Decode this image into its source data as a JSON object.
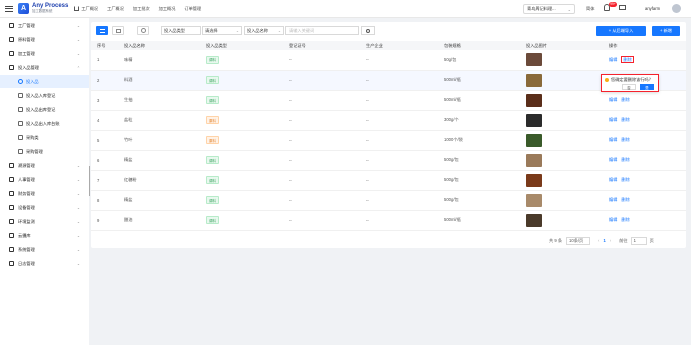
{
  "header": {
    "logo_mark": "A",
    "logo_name": "Any Process",
    "logo_sub": "加工数据系统",
    "nav": [
      "工厂概况",
      "工厂概况",
      "加工批次",
      "加工概况",
      "订单管理"
    ],
    "shop": "青岛周记料理...",
    "lang": "简体",
    "notify_count": "99+",
    "user": "anyfarm"
  },
  "sidebar": {
    "items": [
      {
        "label": "工厂管理",
        "level": 1,
        "arrow": "⌄"
      },
      {
        "label": "原料管理",
        "level": 1,
        "arrow": "⌄"
      },
      {
        "label": "加工管理",
        "level": 1,
        "arrow": "⌄"
      },
      {
        "label": "投入品管理",
        "level": 1,
        "arrow": "⌃"
      },
      {
        "label": "投入品",
        "level": 3,
        "arrow": ""
      },
      {
        "label": "投入品入库登记",
        "level": 2,
        "arrow": ""
      },
      {
        "label": "投入品出库登记",
        "level": 2,
        "arrow": ""
      },
      {
        "label": "投入品出入库台账",
        "level": 2,
        "arrow": ""
      },
      {
        "label": "采购类",
        "level": 2,
        "arrow": ""
      },
      {
        "label": "采购管理",
        "level": 2,
        "arrow": ""
      },
      {
        "label": "溯源管理",
        "level": 1,
        "arrow": "⌄"
      },
      {
        "label": "人事管理",
        "level": 1,
        "arrow": "⌄"
      },
      {
        "label": "财务管理",
        "level": 1,
        "arrow": "⌄"
      },
      {
        "label": "设备管理",
        "level": 1,
        "arrow": "⌄"
      },
      {
        "label": "环境监测",
        "level": 1,
        "arrow": "⌄"
      },
      {
        "label": "云摄库",
        "level": 1,
        "arrow": "⌄"
      },
      {
        "label": "系统管理",
        "level": 1,
        "arrow": "⌄"
      },
      {
        "label": "日志管理",
        "level": 1,
        "arrow": "⌄"
      }
    ]
  },
  "toolbar": {
    "filter_type": "投入品类型",
    "filter_select": "请选择",
    "filter_name": "投入品名称",
    "search_placeholder": "请输入关键词",
    "import_label": "+ 从后端导入",
    "add_label": "+ 新增"
  },
  "table": {
    "columns": [
      "序号",
      "投入品名称",
      "投入品类型",
      "登记证号",
      "生产企业",
      "包装规格",
      "投入品图片",
      "操作"
    ],
    "rows": [
      {
        "no": "1",
        "name": "味精",
        "type": "调料",
        "reg": "--",
        "maker": "--",
        "spec": "50g/包",
        "img": "#6b4a3a",
        "tag": "green"
      },
      {
        "no": "2",
        "name": "料酒",
        "type": "调料",
        "reg": "--",
        "maker": "--",
        "spec": "500ml/瓶",
        "img": "#8a6a3a",
        "tag": "green"
      },
      {
        "no": "3",
        "name": "生抽",
        "type": "调料",
        "reg": "--",
        "maker": "--",
        "spec": "500ml/瓶",
        "img": "#5a2e1a",
        "tag": "green"
      },
      {
        "no": "4",
        "name": "盐粒",
        "type": "原料",
        "reg": "--",
        "maker": "--",
        "spec": "300g/个",
        "img": "#2b2b2b",
        "tag": "orange"
      },
      {
        "no": "5",
        "name": "竹叶",
        "type": "原料",
        "reg": "--",
        "maker": "--",
        "spec": "1000个/袋",
        "img": "#3a5a2a",
        "tag": "orange"
      },
      {
        "no": "6",
        "name": "精盐",
        "type": "调料",
        "reg": "--",
        "maker": "--",
        "spec": "500g/包",
        "img": "#9a7a5a",
        "tag": "green"
      },
      {
        "no": "7",
        "name": "红糖粉",
        "type": "调料",
        "reg": "--",
        "maker": "--",
        "spec": "500g/包",
        "img": "#7a3a1a",
        "tag": "green"
      },
      {
        "no": "8",
        "name": "精盐",
        "type": "调料",
        "reg": "--",
        "maker": "--",
        "spec": "500g/包",
        "img": "#a88a6a",
        "tag": "green"
      },
      {
        "no": "9",
        "name": "醋油",
        "type": "调料",
        "reg": "--",
        "maker": "--",
        "spec": "500ml/瓶",
        "img": "#4a3a2a",
        "tag": "green"
      }
    ],
    "op_edit": "编辑",
    "op_delete": "删除"
  },
  "popconfirm": {
    "message": "您确定要删除该行吗？",
    "cancel": "否",
    "ok": "是"
  },
  "pager": {
    "total": "共 9 条",
    "page_size": "10条/页",
    "current": "1",
    "goto_label": "前往",
    "goto_value": "1",
    "page_suffix": "页"
  },
  "colors": {
    "primary": "#1677ff",
    "danger": "#f5222d"
  }
}
